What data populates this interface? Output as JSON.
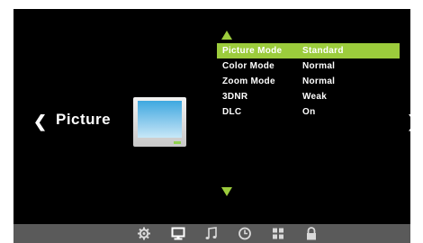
{
  "category": {
    "label": "Picture",
    "left_arrow": "❮",
    "right_arrow": "❯"
  },
  "menu": {
    "items": [
      {
        "label": "Picture Mode",
        "value": "Standard",
        "selected": true
      },
      {
        "label": "Color Mode",
        "value": "Normal",
        "selected": false
      },
      {
        "label": "Zoom Mode",
        "value": "Normal",
        "selected": false
      },
      {
        "label": "3DNR",
        "value": "Weak",
        "selected": false
      },
      {
        "label": "DLC",
        "value": "On",
        "selected": false
      }
    ]
  },
  "bottom_bar": {
    "icons": [
      "gear-icon",
      "monitor-icon",
      "music-note-icon",
      "clock-icon",
      "grid-icon",
      "lock-icon"
    ],
    "active": "monitor-icon"
  },
  "colors": {
    "accent": "#9ccc3c",
    "background": "#000000",
    "bar": "#5a5a5a"
  }
}
